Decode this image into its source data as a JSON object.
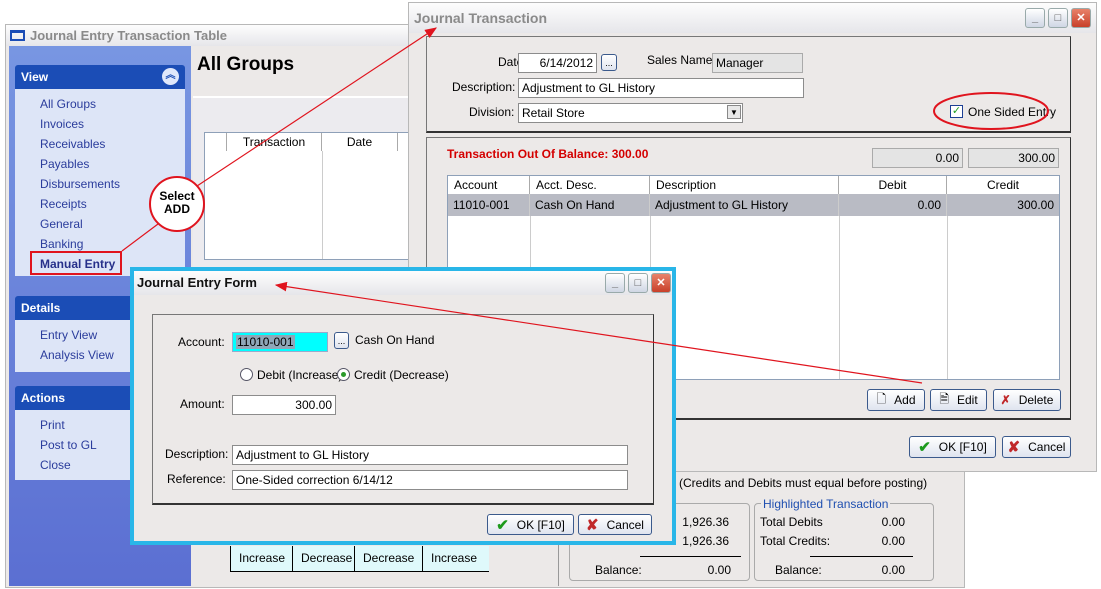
{
  "back_window": {
    "title": "Journal Entry Transaction Table",
    "heading": "All Groups",
    "view": {
      "title": "View",
      "items": [
        "All Groups",
        "Invoices",
        "Receivables",
        "Payables",
        "Disbursements",
        "Receipts",
        "General",
        "Banking",
        "Manual Entry"
      ],
      "selected": "Manual Entry"
    },
    "details": {
      "title": "Details",
      "items": [
        "Entry View",
        "Analysis View"
      ]
    },
    "actions": {
      "title": "Actions",
      "items": [
        "Print",
        "Post to GL",
        "Close"
      ]
    },
    "table_headers": [
      "Transaction",
      "Date"
    ],
    "legend_cells": [
      "Increase",
      "Decrease",
      "Decrease",
      "Increase"
    ],
    "note": "(Credits and Debits must equal before posting)",
    "totals": {
      "debits": "1,926.36",
      "credits": "1,926.36",
      "balance_label": "Balance:",
      "balance": "0.00"
    },
    "highlighted": {
      "title": "Highlighted Transaction",
      "debits_label": "Total Debits",
      "debits": "0.00",
      "credits_label": "Total Credits:",
      "credits": "0.00",
      "balance_label": "Balance:",
      "balance": "0.00"
    }
  },
  "journal_transaction": {
    "title": "Journal Transaction",
    "date_label": "Date:",
    "date": "6/14/2012",
    "sales_name_label": "Sales Name:",
    "sales_name": "Manager",
    "description_label": "Description:",
    "description": "Adjustment to GL History",
    "division_label": "Division:",
    "division": "Retail Store",
    "one_sided_label": "One Sided Entry",
    "one_sided_checked": true,
    "out_of_balance": "Transaction Out Of Balance: 300.00",
    "total_debit": "0.00",
    "total_credit": "300.00",
    "columns": [
      "Account",
      "Acct. Desc.",
      "Description",
      "Debit",
      "Credit"
    ],
    "rows": [
      {
        "account": "11010-001",
        "acct_desc": "Cash On Hand",
        "description": "Adjustment to GL History",
        "debit": "0.00",
        "credit": "300.00"
      }
    ],
    "add": "Add",
    "edit": "Edit",
    "delete": "Delete",
    "ok": "OK [F10]",
    "cancel": "Cancel"
  },
  "entry_form": {
    "title": "Journal Entry Form",
    "account_label": "Account:",
    "account": "11010-001",
    "account_name": "Cash On Hand",
    "debit_label": "Debit (Increase)",
    "credit_label": "Credit (Decrease)",
    "selected": "credit",
    "amount_label": "Amount:",
    "amount": "300.00",
    "description_label": "Description:",
    "description": "Adjustment to GL History",
    "reference_label": "Reference:",
    "reference": "One-Sided correction 6/14/12",
    "ok": "OK [F10]",
    "cancel": "Cancel"
  },
  "annotation": {
    "callout": "Select ADD",
    "color": "#e0141e"
  },
  "colors": {
    "sidebar_header": "#1b4db6",
    "form_border": "#29b6e8",
    "error": "#d40000"
  }
}
